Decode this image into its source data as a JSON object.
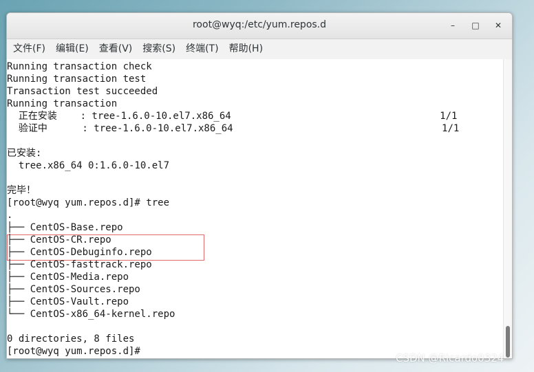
{
  "window": {
    "title": "root@wyq:/etc/yum.repos.d"
  },
  "window_controls": {
    "minimize": "–",
    "maximize": "□",
    "close": "✕"
  },
  "menu": [
    {
      "label": "文件(F)"
    },
    {
      "label": "编辑(E)"
    },
    {
      "label": "查看(V)"
    },
    {
      "label": "搜索(S)"
    },
    {
      "label": "终端(T)"
    },
    {
      "label": "帮助(H)"
    }
  ],
  "terminal": {
    "lines": [
      "Running transaction check",
      "Running transaction test",
      "Transaction test succeeded",
      "Running transaction",
      "  正在安装    : tree-1.6.0-10.el7.x86_64                                    1/1",
      "  验证中      : tree-1.6.0-10.el7.x86_64                                    1/1",
      "",
      "已安装:",
      "  tree.x86_64 0:1.6.0-10.el7",
      "",
      "完毕！",
      "[root@wyq yum.repos.d]# tree",
      ".",
      "├── CentOS-Base.repo",
      "├── CentOS-CR.repo",
      "├── CentOS-Debuginfo.repo",
      "├── CentOS-fasttrack.repo",
      "├── CentOS-Media.repo",
      "├── CentOS-Sources.repo",
      "├── CentOS-Vault.repo",
      "└── CentOS-x86_64-kernel.repo",
      "",
      "0 directories, 8 files",
      "[root@wyq yum.repos.d]#"
    ]
  },
  "watermark": {
    "text": "CSDN @Ricardo0324"
  }
}
